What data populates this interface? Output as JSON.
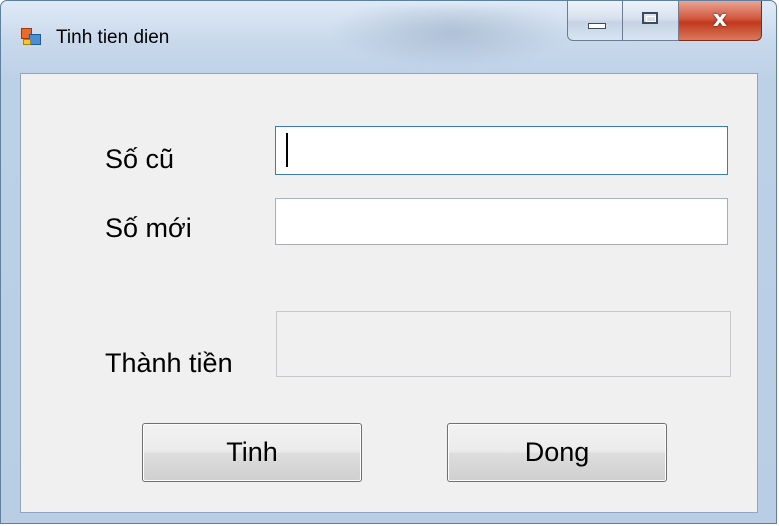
{
  "window": {
    "title": "Tinh tien dien",
    "icon": "app-form-icon",
    "controls": [
      "minimize-icon",
      "maximize-icon",
      "close-icon"
    ],
    "close_glyph": "x"
  },
  "form": {
    "old_reading_label": "Số cũ",
    "old_reading_value": "",
    "new_reading_label": "Số mới",
    "new_reading_value": "",
    "total_label": "Thành tiền",
    "total_value": ""
  },
  "buttons": {
    "calculate_label": "Tinh",
    "close_label": "Dong"
  },
  "colors": {
    "client_background": "#f0f0f0",
    "focus_border": "#3d7bad",
    "close_button": "#c1391e"
  }
}
